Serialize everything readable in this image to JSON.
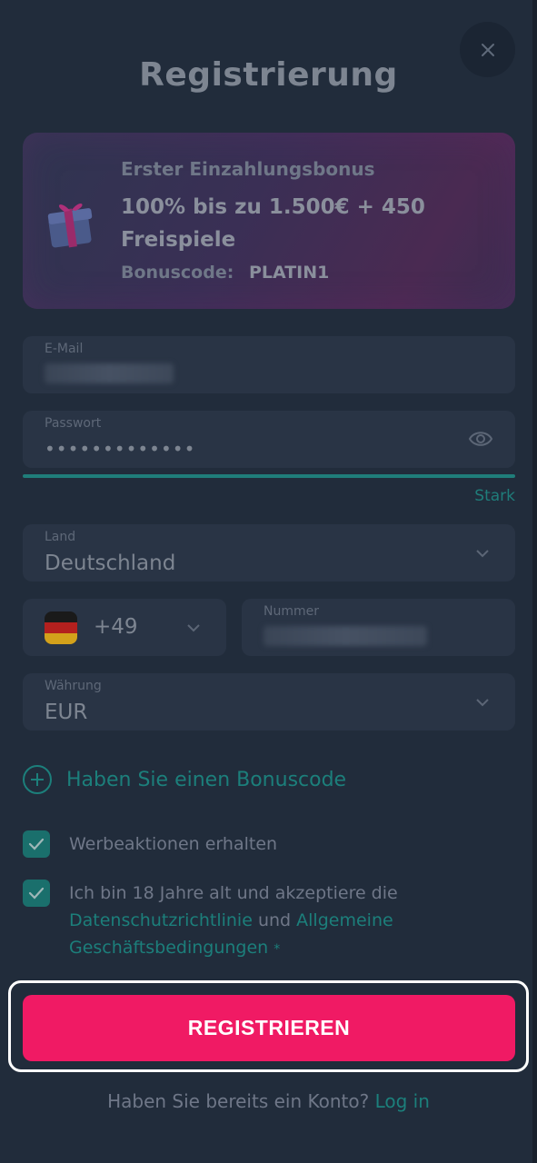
{
  "title": "Registrierung",
  "close_icon": "close-icon",
  "bonus": {
    "subtitle": "Erster Einzahlungsbonus",
    "headline": "100% bis zu 1.500€ + 450 Freispiele",
    "code_label": "Bonuscode:",
    "code_value": "PLATIN1",
    "icon": "gift-icon"
  },
  "email": {
    "label": "E-Mail",
    "value": ""
  },
  "password": {
    "label": "Passwort",
    "value": "•••••••••••••",
    "strength": "Stark",
    "strength_fraction": 1.0
  },
  "country": {
    "label": "Land",
    "value": "Deutschland"
  },
  "phone": {
    "dial_code": "+49",
    "number_label": "Nummer",
    "number_value": ""
  },
  "currency": {
    "label": "Währung",
    "value": "EUR"
  },
  "bonus_code_link": "Haben Sie einen Bonuscode",
  "promotions_checkbox": {
    "label": "Werbeaktionen erhalten",
    "checked": true
  },
  "terms_checkbox": {
    "text_before": "Ich bin 18 Jahre alt und akzeptiere die",
    "privacy_link": "Datenschutzrichtlinie",
    "connector": "und",
    "terms_link": "Allgemeine Geschäftsbedingungen",
    "required_mark": "*",
    "checked": true
  },
  "register_button": "REGISTRIEREN",
  "login_prompt": {
    "text": "Haben Sie bereits ein Konto?",
    "link": "Log in"
  },
  "colors": {
    "accent": "#f01a64",
    "teal": "#1c7f7b",
    "background": "#212c3b"
  }
}
